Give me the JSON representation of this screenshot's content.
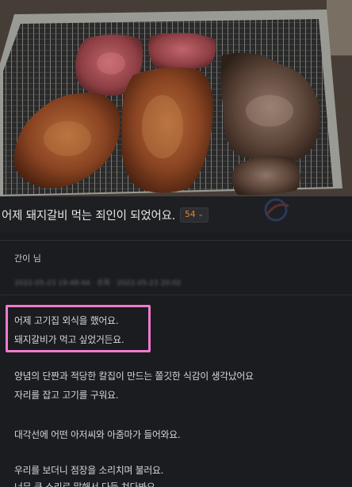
{
  "post": {
    "title": "어제 돼지갈비 먹는 죄인이 되었어요.",
    "comment_count": "54",
    "author": "간이 님",
    "meta": "2022-05-23 19:48:44   ·   조회   ·   2022-05-23 20:02",
    "lines": [
      "어제 고기집 외식을 했어요.",
      "돼지갈비가 먹고 싶었거든요.",
      "양념의 단짠과 적당한 칼집이 만드는 쫄깃한 식감이 생각났어요",
      "자리를 잡고 고기를 구워요.",
      "대각선에 어떤 아저씨와 아줌마가 들어와요.",
      "우리를 보더니 점장을 소리치며 불러요.",
      "너무 큰 소리로 말해서 다들 쳐다봐요."
    ]
  },
  "colors": {
    "background": "#1b1c1f",
    "highlight": "#f07ad0",
    "count": "#e8862a"
  },
  "icons": {
    "dropdown": "chevron-down-icon",
    "watermark": "site-logo-watermark"
  }
}
